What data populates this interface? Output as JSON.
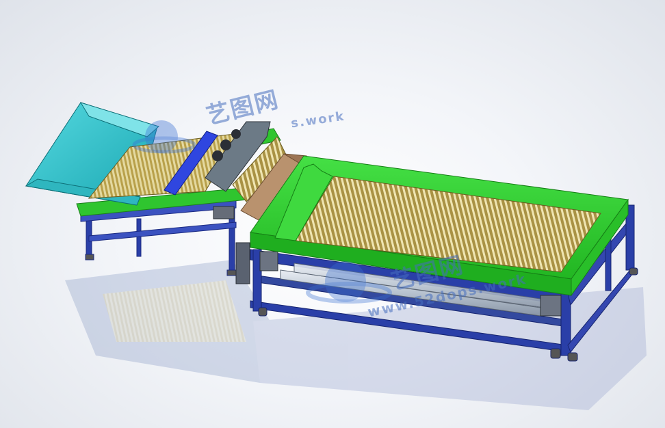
{
  "watermarks": [
    {
      "cjk": "艺图网",
      "url": "s.work"
    },
    {
      "cjk": "艺图网",
      "url": "www.52dops.work"
    }
  ],
  "colors": {
    "background": "#eef1f6",
    "hopper": "#36c6cf",
    "frame": "#2a3fa8",
    "conveyor_green": "#2fd12f",
    "rollers": "#c8b45a",
    "chute": "#b9926e",
    "watermark": "#4a78c8"
  }
}
